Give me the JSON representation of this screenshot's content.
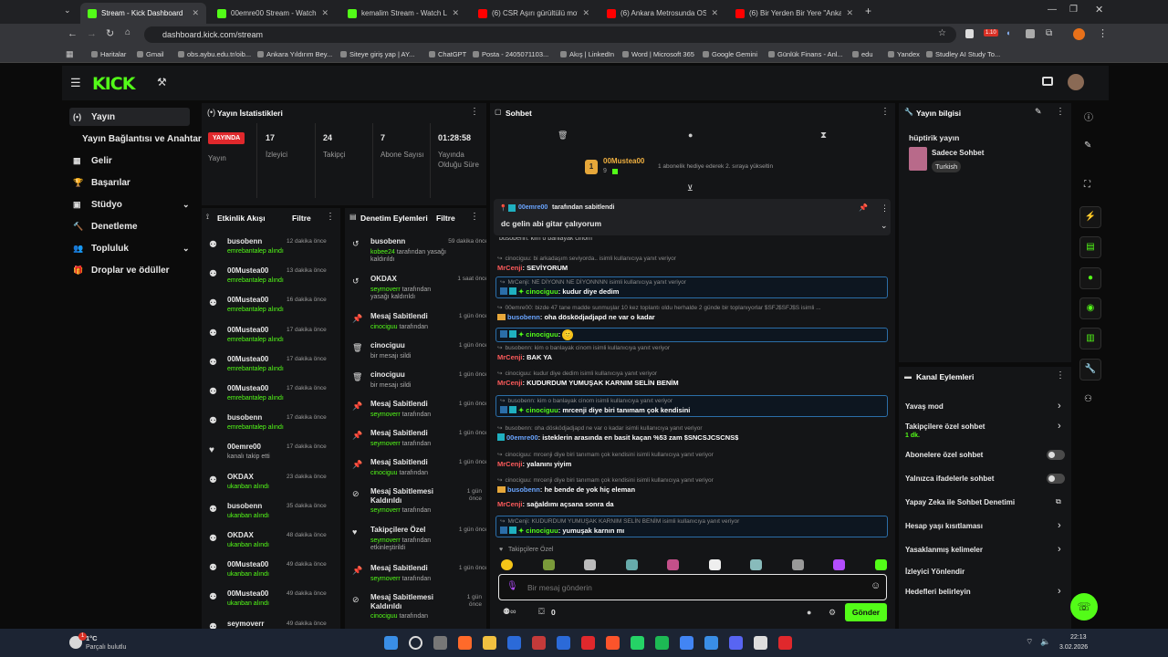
{
  "browser": {
    "tabs": [
      {
        "title": "Stream - Kick Dashboard",
        "fav": "k"
      },
      {
        "title": "00emre00 Stream - Watch Live",
        "fav": "k"
      },
      {
        "title": "kemalim Stream - Watch Live o",
        "fav": "k"
      },
      {
        "title": "(6) CSR Aşırı gürültülü motor se",
        "fav": "y"
      },
      {
        "title": "(6) Ankara Metrosunda OSB Tö",
        "fav": "y"
      },
      {
        "title": "(6) Bir Yerden Bir Yere \"Ankara\"",
        "fav": "y"
      }
    ],
    "url": "dashboard.kick.com/stream",
    "bookmarks": [
      "Haritalar",
      "Gmail",
      "obs.aybu.edu.tr/oib...",
      "Ankara Yıldırım Bey...",
      "Siteye giriş yap | AY...",
      "ChatGPT",
      "Posta - 2405071103...",
      "Akış | LinkedIn",
      "Word | Microsoft 365",
      "Google Gemini",
      "Günlük Finans - Anl...",
      "edu",
      "Yandex",
      "Studley AI Study To..."
    ],
    "ext_badge": "1.10"
  },
  "logo": "KICK",
  "sidebar": [
    {
      "label": "Yayın",
      "icon": "(•)"
    },
    {
      "label": "Yayın Bağlantısı ve Anahtarı",
      "icon": ""
    },
    {
      "label": "Gelir",
      "icon": "▦"
    },
    {
      "label": "Başarılar",
      "icon": "🏆"
    },
    {
      "label": "Stüdyo",
      "icon": "▣"
    },
    {
      "label": "Denetleme",
      "icon": "🔨"
    },
    {
      "label": "Topluluk",
      "icon": "👥"
    },
    {
      "label": "Droplar ve ödüller",
      "icon": "🎁"
    }
  ],
  "stats": {
    "title": "Yayın İstatistikleri",
    "live": "YAYINDA",
    "live_label": "Yayın",
    "items": [
      {
        "v": "17",
        "l": "İzleyici"
      },
      {
        "v": "24",
        "l": "Takipçi"
      },
      {
        "v": "7",
        "l": "Abone Sayısı"
      },
      {
        "v": "01:28:58",
        "l": "Yayında Olduğu Süre"
      }
    ]
  },
  "activity": {
    "title": "Etkinlik Akışı",
    "filter": "Filtre",
    "items": [
      {
        "n": "busobenn",
        "s": "emrebantalep alındı",
        "t": "12 dakika önce"
      },
      {
        "n": "00Mustea00",
        "s": "emrebantalep alındı",
        "t": "13 dakika önce"
      },
      {
        "n": "00Mustea00",
        "s": "emrebantalep alındı",
        "t": "16 dakika önce"
      },
      {
        "n": "00Mustea00",
        "s": "emrebantalep alındı",
        "t": "17 dakika önce"
      },
      {
        "n": "00Mustea00",
        "s": "emrebantalep alındı",
        "t": "17 dakika önce"
      },
      {
        "n": "00Mustea00",
        "s": "emrebantalep alındı",
        "t": "17 dakika önce"
      },
      {
        "n": "busobenn",
        "s": "emrebantalep alındı",
        "t": "17 dakika önce"
      },
      {
        "n": "00emre00",
        "s": "kanalı takip etti",
        "t": "17 dakika önce"
      },
      {
        "n": "OKDAX",
        "s": "ukanban alındı",
        "t": "23 dakika önce"
      },
      {
        "n": "busobenn",
        "s": "ukanban alındı",
        "t": "35 dakika önce"
      },
      {
        "n": "OKDAX",
        "s": "ukanban alındı",
        "t": "48 dakika önce"
      },
      {
        "n": "00Mustea00",
        "s": "ukanban alındı",
        "t": "49 dakika önce"
      },
      {
        "n": "00Mustea00",
        "s": "ukanban alındı",
        "t": "49 dakika önce"
      },
      {
        "n": "seymoverr",
        "s": "",
        "t": "49 dakika önce"
      }
    ]
  },
  "mod": {
    "title": "Denetim Eylemleri",
    "filter": "Filtre",
    "items": [
      {
        "n": "busobenn",
        "s1": "kobee24",
        "s2": " tarafından yasağı kaldırıldı",
        "t": "59 dakika önce"
      },
      {
        "n": "OKDAX",
        "s1": "seymoverr",
        "s2": " tarafından yasağı kaldırıldı",
        "t": "1 saat önce"
      },
      {
        "n": "Mesaj Sabitlendi",
        "s1": "cinociguu",
        "s2": " tarafından",
        "t": "1 gün önce"
      },
      {
        "n": "cinociguu",
        "s1": "",
        "s2": "bir mesajı sildi",
        "t": "1 gün önce"
      },
      {
        "n": "cinociguu",
        "s1": "",
        "s2": "bir mesajı sildi",
        "t": "1 gün önce"
      },
      {
        "n": "Mesaj Sabitlendi",
        "s1": "seymoverr",
        "s2": " tarafından",
        "t": "1 gün önce"
      },
      {
        "n": "Mesaj Sabitlendi",
        "s1": "seymoverr",
        "s2": " tarafından",
        "t": "1 gün önce"
      },
      {
        "n": "Mesaj Sabitlendi",
        "s1": "cinociguu",
        "s2": " tarafından",
        "t": "1 gün önce"
      },
      {
        "n": "Mesaj Sabitlemesi Kaldırıldı",
        "s1": "seymoverr",
        "s2": " tarafından",
        "t": "1 gün önce"
      },
      {
        "n": "Takipçilere Özel",
        "s1": "seymoverr",
        "s2": " tarafından etkinleştirildi",
        "t": "1 gün önce"
      },
      {
        "n": "Mesaj Sabitlendi",
        "s1": "seymoverr",
        "s2": " tarafından",
        "t": "1 gün önce"
      },
      {
        "n": "Mesaj Sabitlemesi Kaldırıldı",
        "s1": "cinociguu",
        "s2": " tarafından",
        "t": "1 gün önce"
      }
    ]
  },
  "chat": {
    "title": "Sohbet",
    "gift_user": "00Mustea00",
    "gift_count": "9",
    "gift_text": "1 abonelik hediye ederek 2. sıraya yükseltin",
    "pinned_by": "00emre00",
    "pinned_suffix": " tarafından sabitlendi",
    "pinned_msg": "dc gelin abi gitar çalıyorum",
    "cut_line": "busobenn: kim o banlayak cinom",
    "messages": [
      {
        "r": "cinociguu: bi arkadaşım seviyorda.. isimli kullanıcıya yanıt veriyor",
        "u": "MrCenji",
        "uc": "#ff5b5b",
        "m": "SEVİYORUM",
        "box": false
      },
      {
        "r": "MrCenji: NE DİYONN NE DİYONNNN isimli kullanıcıya yanıt veriyor",
        "u": "cinociguu",
        "uc": "#53fc18",
        "m": "kudur diye dedim",
        "box": true
      },
      {
        "r": "00emre00: bizde 47 tane madde sunmuşlar 10 kez toplantı oldu herhalde 2 günde bir toplanıyorlar $SFJ$SFJ$S isimli ...",
        "u": "busobenn",
        "uc": "#6aa5ff",
        "m": "oha dösködjadjapd ne var o kadar",
        "box": false
      },
      {
        "r": "",
        "u": "cinociguu",
        "uc": "#53fc18",
        "m": "🙂",
        "box": true
      },
      {
        "r": "busobenn: kim o banlayak cinom isimli kullanıcıya yanıt veriyor",
        "u": "MrCenji",
        "uc": "#ff5b5b",
        "m": "BAK YA",
        "box": false
      },
      {
        "r": "cinociguu: kudur diye dedim isimli kullanıcıya yanıt veriyor",
        "u": "MrCenji",
        "uc": "#ff5b5b",
        "m": "KUDURDUM YUMUŞAK KARNIM SELİN BENİM",
        "box": false
      },
      {
        "r": "busobenn: kim o banlayak cinom isimli kullanıcıya yanıt veriyor",
        "u": "cinociguu",
        "uc": "#53fc18",
        "m": "mrcenji diye biri tanımam çok kendisini",
        "box": true
      },
      {
        "r": "busobenn: oha dösködjadjapd ne var o kadar isimli kullanıcıya yanıt veriyor",
        "u": "00emre00",
        "uc": "#6aa5ff",
        "m": "isteklerin arasında en basit kaçan %53 zam $SNCSJCSCNS$",
        "box": false
      },
      {
        "r": "cinociguu: mrcenji diye biri tanımam çok kendisini isimli kullanıcıya yanıt veriyor",
        "u": "MrCenji",
        "uc": "#ff5b5b",
        "m": "yalanını yiyim",
        "box": false
      },
      {
        "r": "cinociguu: mrcenji diye biri tanımam çok kendisini isimli kullanıcıya yanıt veriyor",
        "u": "busobenn",
        "uc": "#6aa5ff",
        "m": "he bende de yok hiç eleman",
        "box": false
      },
      {
        "r": "",
        "u": "MrCenji",
        "uc": "#ff5b5b",
        "m": "sağaldımı açsana sonra da",
        "box": false
      },
      {
        "r": "MrCenji: KUDURDUM YUMUŞAK KARNIM SELİN BENİM isimli kullanıcıya yanıt veriyor",
        "u": "cinociguu",
        "uc": "#53fc18",
        "m": "yumuşak karnın mı",
        "box": true
      }
    ],
    "followers_only": "Takipçilere Özel",
    "input_placeholder": "Bir mesaj gönderin",
    "count": "0",
    "send": "Gönder"
  },
  "info": {
    "title": "Yayın bilgisi",
    "stream_title": "hüptirik yayın",
    "category": "Sadece Sohbet",
    "tag": "Turkish"
  },
  "channel": {
    "title": "Kanal Eylemleri",
    "items": [
      {
        "l": "Yavaş mod",
        "k": "arrow"
      },
      {
        "l": "Takipçilere özel sohbet",
        "sub": "1 dk.",
        "k": "arrow"
      },
      {
        "l": "Abonelere özel sohbet",
        "k": "toggle"
      },
      {
        "l": "Yalnızca ifadelerle sohbet",
        "k": "toggle"
      },
      {
        "l": "Yapay Zeka ile Sohbet Denetimi",
        "k": "ext"
      },
      {
        "l": "Hesap yaşı kısıtlaması",
        "k": "arrow"
      },
      {
        "l": "Yasaklanmış kelimeler",
        "k": "arrow"
      },
      {
        "l": "İzleyici Yönlendir",
        "k": ""
      },
      {
        "l": "Hedefleri belirleyin",
        "k": "arrow"
      }
    ]
  },
  "taskbar": {
    "temp": "1°C",
    "weather": "Parçalı bulutlu",
    "time": "22:13",
    "date": "3.02.2026",
    "badge": "1"
  }
}
